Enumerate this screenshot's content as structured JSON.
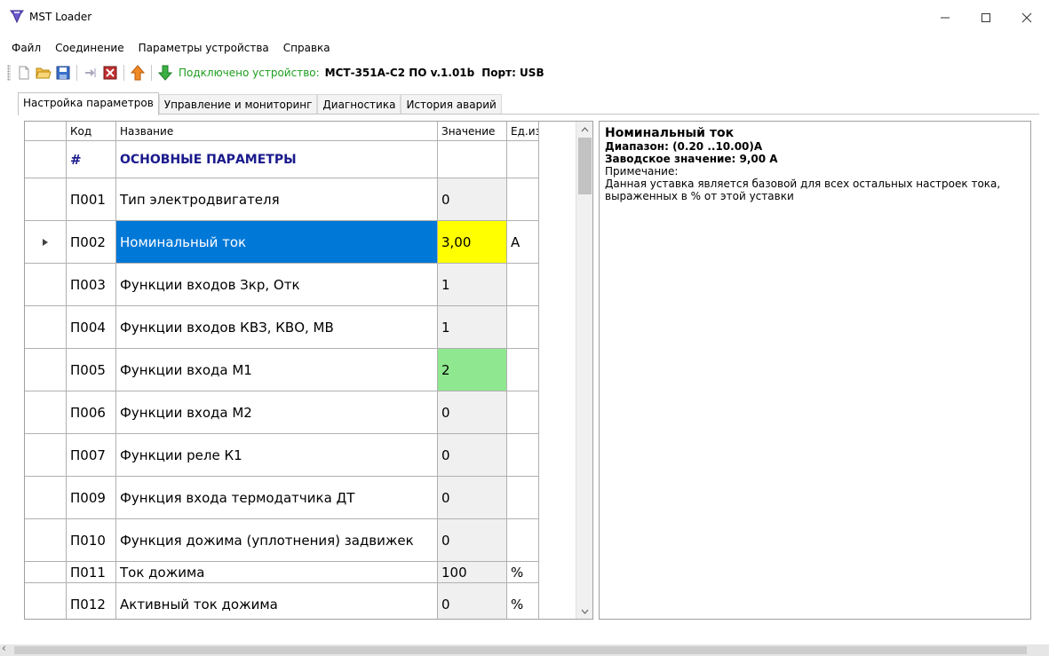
{
  "window": {
    "title": "MST Loader"
  },
  "menu": [
    "Файл",
    "Соединение",
    "Параметры устройства",
    "Справка"
  ],
  "toolbar": {
    "connected_label": "Подключено устройство:",
    "device": "МСТ-351А-С2 ПО v.1.01b",
    "port": "Порт: USB"
  },
  "tabs": [
    "Настройка параметров",
    "Управление и мониторинг",
    "Диагностика",
    "История аварий"
  ],
  "active_tab": 0,
  "grid": {
    "headers": {
      "code": "Код",
      "name": "Название",
      "value": "Значение",
      "unit": "Ед.изм"
    },
    "rows": [
      {
        "code": "#",
        "name": "ОСНОВНЫЕ ПАРАМЕТРЫ",
        "value": "",
        "unit": "",
        "section": true
      },
      {
        "code": "П001",
        "name": "Тип электродвигателя",
        "value": "0",
        "unit": ""
      },
      {
        "code": "П002",
        "name": "Номинальный ток",
        "value": "3,00",
        "unit": "А",
        "selected": true,
        "highlight": "yellow"
      },
      {
        "code": "П003",
        "name": "Функции входов Зкр, Отк",
        "value": "1",
        "unit": ""
      },
      {
        "code": "П004",
        "name": "Функции входов КВЗ, КВО, МВ",
        "value": "1",
        "unit": ""
      },
      {
        "code": "П005",
        "name": "Функции входа М1",
        "value": "2",
        "unit": "",
        "highlight": "green"
      },
      {
        "code": "П006",
        "name": "Функции входа М2",
        "value": "0",
        "unit": ""
      },
      {
        "code": "П007",
        "name": "Функции реле К1",
        "value": "0",
        "unit": ""
      },
      {
        "code": "П009",
        "name": "Функция входа термодатчика ДТ",
        "value": "0",
        "unit": ""
      },
      {
        "code": "П010",
        "name": "Функция дожима (уплотнения) задвижек",
        "value": "0",
        "unit": ""
      },
      {
        "code": "П011",
        "name": "Ток дожима",
        "value": "100",
        "unit": "%"
      },
      {
        "code": "П012",
        "name": "Активный ток дожима",
        "value": "0",
        "unit": "%"
      }
    ]
  },
  "info": {
    "title": "Номинальный ток",
    "range": "Диапазон: (0.20 ..10.00)А",
    "factory": "Заводское значение: 9,00 А",
    "note_label": "Примечание:",
    "note_text": "Данная уставка является базовой для всех остальных настроек тока, выраженных в % от этой уставки"
  },
  "colors": {
    "selection": "#0078d7",
    "yellow": "#ffff00",
    "green": "#8fe88f",
    "connected": "#1e9e1e"
  },
  "icons": [
    "app-icon",
    "new-file-icon",
    "open-folder-icon",
    "save-icon",
    "export-icon",
    "stop-icon",
    "upload-arrow-icon",
    "download-arrow-icon"
  ]
}
